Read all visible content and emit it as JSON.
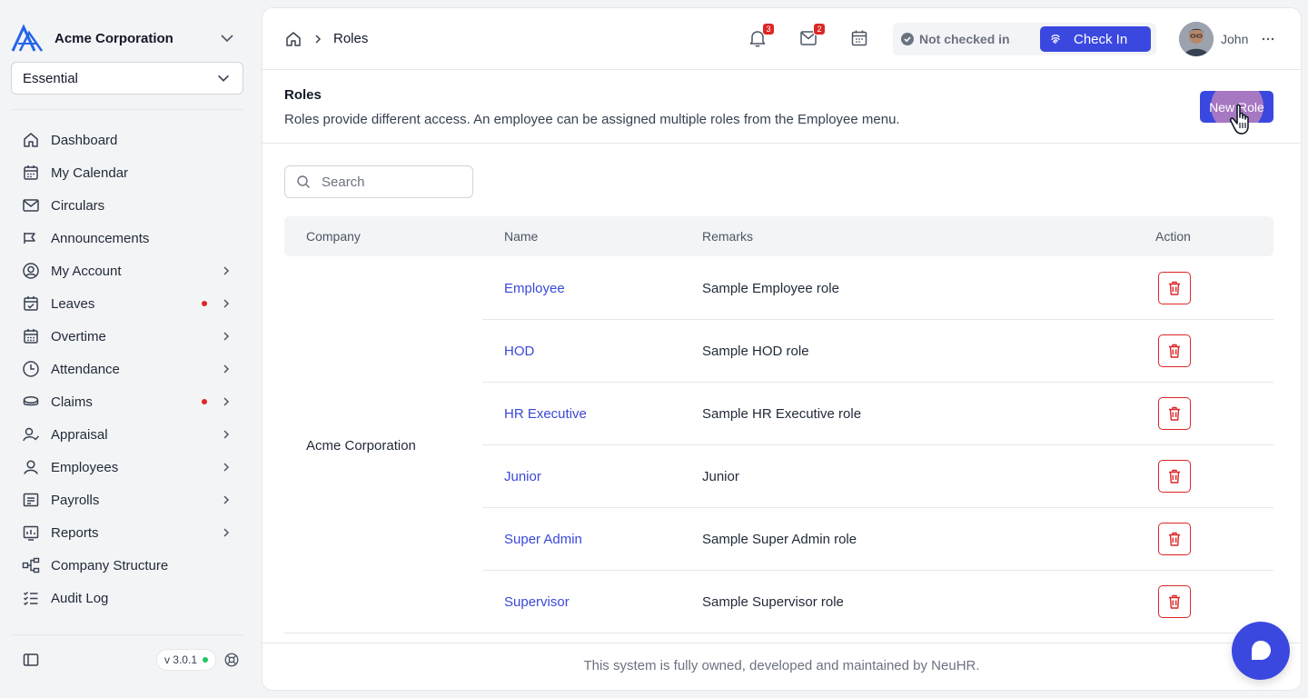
{
  "colors": {
    "accent": "#3b48e0",
    "link": "#3b48d8",
    "danger": "#dc2626",
    "online": "#22c55e"
  },
  "sidebar": {
    "org_name": "Acme Corporation",
    "plan": "Essential",
    "version": "v 3.0.1",
    "items": [
      {
        "label": "Dashboard",
        "icon": "home-icon",
        "chevron": false,
        "dot": false
      },
      {
        "label": "My Calendar",
        "icon": "calendar-icon",
        "chevron": false,
        "dot": false
      },
      {
        "label": "Circulars",
        "icon": "mail-icon",
        "chevron": false,
        "dot": false
      },
      {
        "label": "Announcements",
        "icon": "megaphone-icon",
        "chevron": false,
        "dot": false
      },
      {
        "label": "My Account",
        "icon": "user-circle-icon",
        "chevron": true,
        "dot": false
      },
      {
        "label": "Leaves",
        "icon": "calendar-check-icon",
        "chevron": true,
        "dot": true
      },
      {
        "label": "Overtime",
        "icon": "calendar-grid-icon",
        "chevron": true,
        "dot": false
      },
      {
        "label": "Attendance",
        "icon": "clock-icon",
        "chevron": true,
        "dot": false
      },
      {
        "label": "Claims",
        "icon": "coins-icon",
        "chevron": true,
        "dot": true
      },
      {
        "label": "Appraisal",
        "icon": "user-check-icon",
        "chevron": true,
        "dot": false
      },
      {
        "label": "Employees",
        "icon": "person-icon",
        "chevron": true,
        "dot": false
      },
      {
        "label": "Payrolls",
        "icon": "payslip-icon",
        "chevron": true,
        "dot": false
      },
      {
        "label": "Reports",
        "icon": "report-chart-icon",
        "chevron": true,
        "dot": false
      },
      {
        "label": "Company Structure",
        "icon": "hierarchy-icon",
        "chevron": false,
        "dot": false
      },
      {
        "label": "Audit Log",
        "icon": "checklist-icon",
        "chevron": false,
        "dot": false
      }
    ]
  },
  "topbar": {
    "breadcrumb_current": "Roles",
    "notifications_count": "3",
    "inbox_count": "2",
    "checkin_status": "Not checked in",
    "checkin_button": "Check In",
    "user_name": "John"
  },
  "page": {
    "title": "Roles",
    "description": "Roles provide different access. An employee can be assigned multiple roles from the Employee menu.",
    "new_button": "New Role",
    "search_placeholder": "Search"
  },
  "table": {
    "headers": {
      "company": "Company",
      "name": "Name",
      "remarks": "Remarks",
      "action": "Action"
    },
    "company": "Acme Corporation",
    "rows": [
      {
        "name": "Employee",
        "remarks": "Sample Employee role"
      },
      {
        "name": "HOD",
        "remarks": "Sample HOD role"
      },
      {
        "name": "HR Executive",
        "remarks": "Sample HR Executive role"
      },
      {
        "name": "Junior",
        "remarks": "Junior"
      },
      {
        "name": "Super Admin",
        "remarks": "Sample Super Admin role"
      },
      {
        "name": "Supervisor",
        "remarks": "Sample Supervisor role"
      }
    ]
  },
  "footer": {
    "text": "This system is fully owned, developed and maintained by NeuHR."
  }
}
